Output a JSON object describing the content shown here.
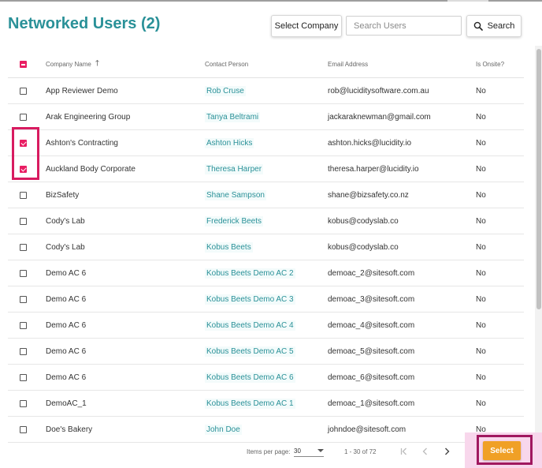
{
  "header": {
    "title": "Networked Users (2)",
    "select_company_label": "Select Company",
    "search_placeholder": "Search Users",
    "search_button_label": "Search"
  },
  "table": {
    "columns": {
      "company": "Company Name",
      "contact": "Contact Person",
      "email": "Email Address",
      "onsite": "Is Onsite?"
    },
    "sort": {
      "column": "company",
      "direction": "ascending"
    },
    "rows": [
      {
        "company": "App Reviewer Demo",
        "contact": "Rob Cruse",
        "email": "rob@luciditysoftware.com.au",
        "onsite": "No",
        "checked": false
      },
      {
        "company": "Arak Engineering Group",
        "contact": "Tanya Beltrami",
        "email": "jackaraknewman@gmail.com",
        "onsite": "No",
        "checked": false
      },
      {
        "company": "Ashton's Contracting",
        "contact": "Ashton Hicks",
        "email": "ashton.hicks@lucidity.io",
        "onsite": "No",
        "checked": true
      },
      {
        "company": "Auckland Body Corporate",
        "contact": "Theresa Harper",
        "email": "theresa.harper@lucidity.io",
        "onsite": "No",
        "checked": true
      },
      {
        "company": "BizSafety",
        "contact": "Shane Sampson",
        "email": "shane@bizsafety.co.nz",
        "onsite": "No",
        "checked": false
      },
      {
        "company": "Cody's Lab",
        "contact": "Frederick Beets",
        "email": "kobus@codyslab.co",
        "onsite": "No",
        "checked": false
      },
      {
        "company": "Cody's Lab",
        "contact": "Kobus Beets",
        "email": "kobus@codyslab.co",
        "onsite": "No",
        "checked": false
      },
      {
        "company": "Demo AC 6",
        "contact": "Kobus Beets Demo AC 2",
        "email": "demoac_2@sitesoft.com",
        "onsite": "No",
        "checked": false
      },
      {
        "company": "Demo AC 6",
        "contact": "Kobus Beets Demo AC 3",
        "email": "demoac_3@sitesoft.com",
        "onsite": "No",
        "checked": false
      },
      {
        "company": "Demo AC 6",
        "contact": "Kobus Beets Demo AC 4",
        "email": "demoac_4@sitesoft.com",
        "onsite": "No",
        "checked": false
      },
      {
        "company": "Demo AC 6",
        "contact": "Kobus Beets Demo AC 5",
        "email": "demoac_5@sitesoft.com",
        "onsite": "No",
        "checked": false
      },
      {
        "company": "Demo AC 6",
        "contact": "Kobus Beets Demo AC 6",
        "email": "demoac_6@sitesoft.com",
        "onsite": "No",
        "checked": false
      },
      {
        "company": "DemoAC_1",
        "contact": "Kobus Beets Demo AC 1",
        "email": "demoac_1@sitesoft.com",
        "onsite": "No",
        "checked": false
      },
      {
        "company": "Doe's Bakery",
        "contact": "John Doe",
        "email": "johndoe@sitesoft.com",
        "onsite": "No",
        "checked": false
      }
    ]
  },
  "paginator": {
    "items_per_page_label": "Items per page:",
    "items_per_page_value": "30",
    "range_label": "1 - 30 of 72"
  },
  "footer": {
    "select_label": "Select"
  },
  "colors": {
    "title": "#2a9198",
    "checkbox_checked": "#e91e63",
    "highlight_border": "#d81b60",
    "select_button": "#f0a026",
    "select_highlight": "#f8d7ec"
  }
}
